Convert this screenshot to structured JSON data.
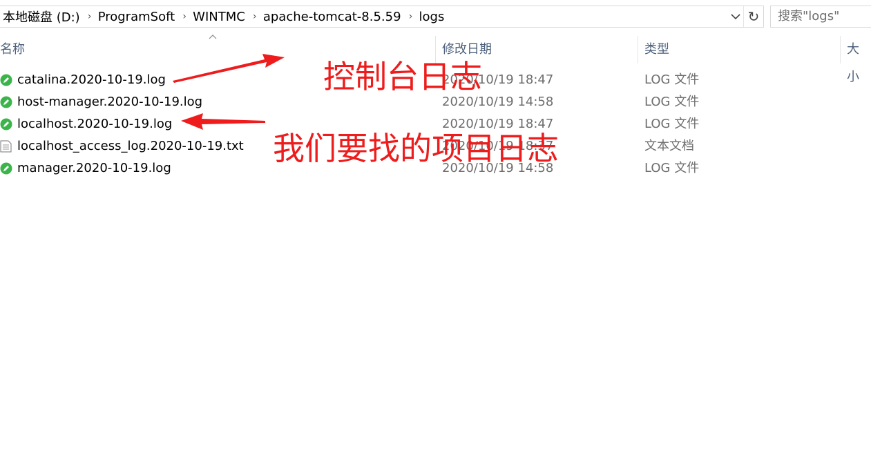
{
  "address_bar": {
    "crumbs": [
      "本地磁盘 (D:)",
      "ProgramSoft",
      "WINTMC",
      "apache-tomcat-8.5.59",
      "logs"
    ]
  },
  "search": {
    "placeholder": "搜索\"logs\""
  },
  "columns": {
    "name": "名称",
    "date": "修改日期",
    "type": "类型",
    "size": "大小"
  },
  "files": [
    {
      "name": "catalina.2020-10-19.log",
      "date": "2020/10/19 18:47",
      "type": "LOG 文件",
      "icon": "log-file-icon"
    },
    {
      "name": "host-manager.2020-10-19.log",
      "date": "2020/10/19 14:58",
      "type": "LOG 文件",
      "icon": "log-file-icon"
    },
    {
      "name": "localhost.2020-10-19.log",
      "date": "2020/10/19 18:47",
      "type": "LOG 文件",
      "icon": "log-file-icon"
    },
    {
      "name": "localhost_access_log.2020-10-19.txt",
      "date": "2020/10/19 18:37",
      "type": "文本文档",
      "icon": "text-file-icon"
    },
    {
      "name": "manager.2020-10-19.log",
      "date": "2020/10/19 14:58",
      "type": "LOG 文件",
      "icon": "log-file-icon"
    }
  ],
  "annotations": {
    "console_log": "控制台日志",
    "project_log": "我们要找的项目日志",
    "color": "#ee1c1c"
  }
}
